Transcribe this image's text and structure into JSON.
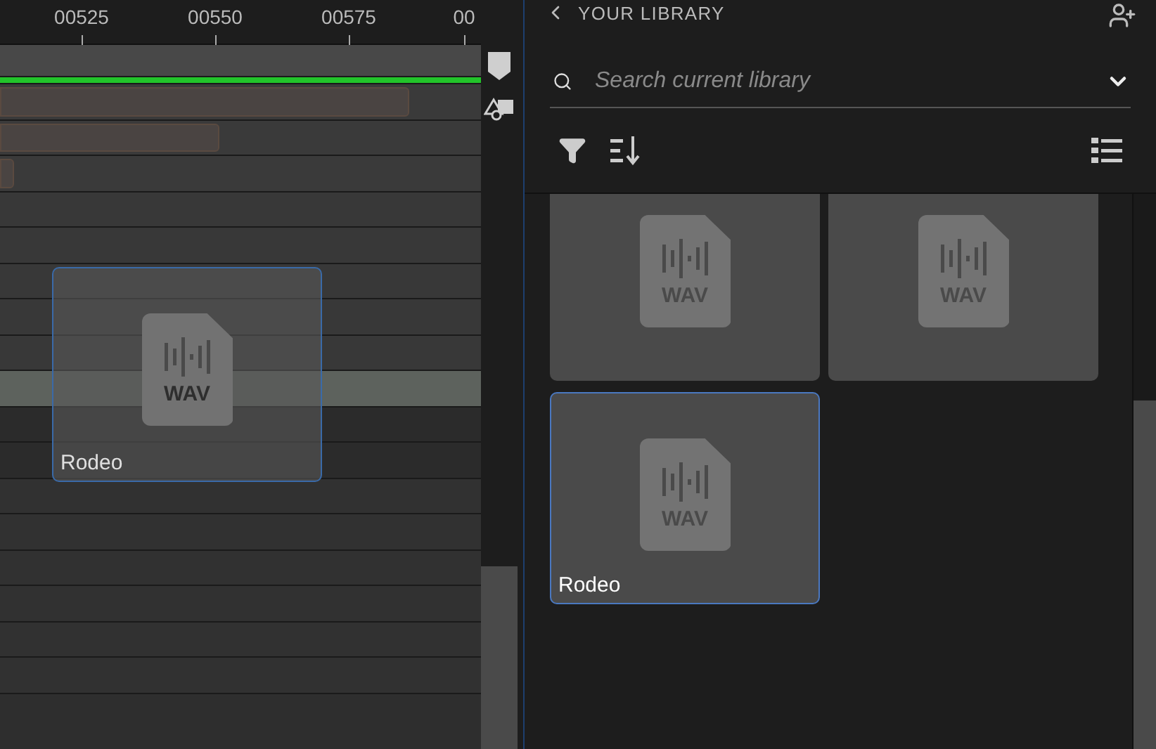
{
  "timeline": {
    "ruler": [
      "00525",
      "00550",
      "00575",
      "00"
    ],
    "tracks": [
      {
        "kind": "bar"
      },
      {
        "kind": "playhead"
      },
      {
        "kind": "clip",
        "level": 0.85
      },
      {
        "kind": "clip",
        "level": 0.455
      },
      {
        "kind": "clip",
        "level": 0.03
      },
      {
        "kind": "empty"
      },
      {
        "kind": "empty"
      },
      {
        "kind": "empty"
      },
      {
        "kind": "empty"
      },
      {
        "kind": "empty"
      },
      {
        "kind": "highlighted"
      },
      {
        "kind": "dim"
      },
      {
        "kind": "dim"
      },
      {
        "kind": "empty"
      },
      {
        "kind": "empty"
      },
      {
        "kind": "empty"
      },
      {
        "kind": "empty"
      },
      {
        "kind": "empty"
      },
      {
        "kind": "empty"
      }
    ],
    "drag_preview": {
      "badge": "WAV",
      "name": "Rodeo"
    }
  },
  "library": {
    "title": "YOUR LIBRARY",
    "search": {
      "placeholder": "Search current library"
    },
    "items": [
      {
        "badge": "WAV",
        "selected": false
      },
      {
        "badge": "WAV",
        "selected": false
      },
      {
        "badge": "WAV",
        "name": "Rodeo",
        "selected": true
      }
    ]
  }
}
